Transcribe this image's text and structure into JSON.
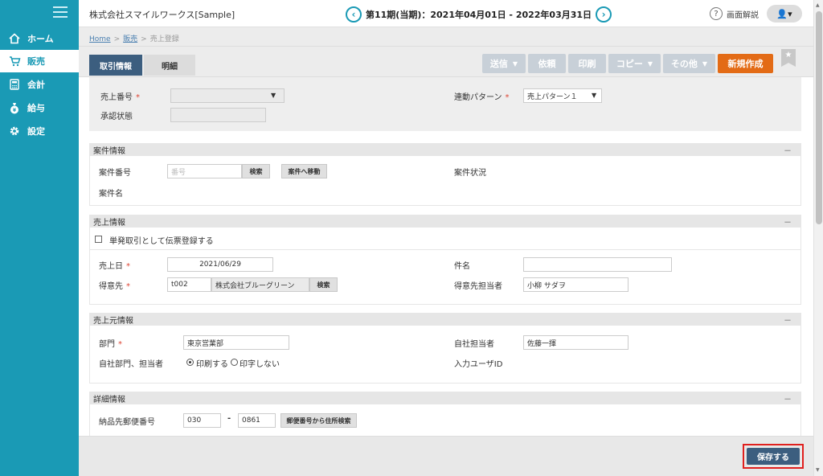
{
  "sidebar": {
    "items": [
      {
        "label": "ホーム",
        "icon": "home-icon"
      },
      {
        "label": "販売",
        "icon": "cart-icon"
      },
      {
        "label": "会計",
        "icon": "calculator-icon"
      },
      {
        "label": "給与",
        "icon": "money-bag-icon"
      },
      {
        "label": "設定",
        "icon": "gear-icon"
      }
    ]
  },
  "header": {
    "company": "株式会社スマイルワークス[Sample]",
    "period": "第11期(当期)：2021年04月01日 - 2022年03月31日",
    "prev_glyph": "‹",
    "next_glyph": "›",
    "help": "画面解説",
    "help_glyph": "?",
    "user_glyph": "👤▾"
  },
  "breadcrumb": {
    "home": "Home",
    "sales": "販売",
    "current": "売上登録",
    "separator": ">"
  },
  "tabs": {
    "deal": "取引情報",
    "detail": "明細"
  },
  "toolbar": {
    "send": "送信",
    "request": "依頼",
    "print": "印刷",
    "copy": "コピー",
    "other": "その他",
    "new": "新規作成",
    "dropdown_glyph": "▼",
    "bookmark_glyph": "★"
  },
  "top_form": {
    "sales_number_label": "売上番号",
    "sales_number_value": "",
    "approval_status_label": "承認状態",
    "approval_status_value": "",
    "link_pattern_label": "連動パターン",
    "link_pattern_value": "売上パターン１",
    "required_mark": "*",
    "dropdown_glyph": "▼"
  },
  "project": {
    "title": "案件情報",
    "collapse_glyph": "－",
    "number_label": "案件番号",
    "number_placeholder": "番号",
    "search_button": "検索",
    "move_button": "案件へ移動",
    "status_label": "案件状況",
    "name_label": "案件名"
  },
  "sales": {
    "title": "売上情報",
    "collapse_glyph": "－",
    "single_checkbox_label": "単発取引として伝票登録する",
    "date_label": "売上日",
    "date_value": "2021/06/29",
    "subject_label": "件名",
    "subject_value": "",
    "customer_label": "得意先",
    "customer_code": "t002",
    "customer_name": "株式会社ブルーグリーン",
    "search_button": "検索",
    "customer_rep_label": "得意先担当者",
    "customer_rep_value": "小柳 サダヲ",
    "required_mark": "*"
  },
  "source": {
    "title": "売上元情報",
    "collapse_glyph": "－",
    "dept_label": "部門",
    "dept_value": "東京営業部",
    "staff_label": "自社担当者",
    "staff_value": "佐藤一揮",
    "print_label": "自社部門、担当者",
    "print_on": "印刷する",
    "print_off": "印字しない",
    "input_user_label": "入力ユーザID",
    "required_mark": "*"
  },
  "detail": {
    "title": "詳細情報",
    "collapse_glyph": "－",
    "postal_label": "納品先郵便番号",
    "postal_1": "030",
    "postal_dash": "-",
    "postal_2": "0861",
    "postal_search": "郵便番号から住所検索"
  },
  "footer": {
    "save": "保存する"
  },
  "colors": {
    "sidebar": "#1a9ab5",
    "navy": "#3c5e7f",
    "orange": "#e36b16",
    "highlight": "#e0201e"
  }
}
